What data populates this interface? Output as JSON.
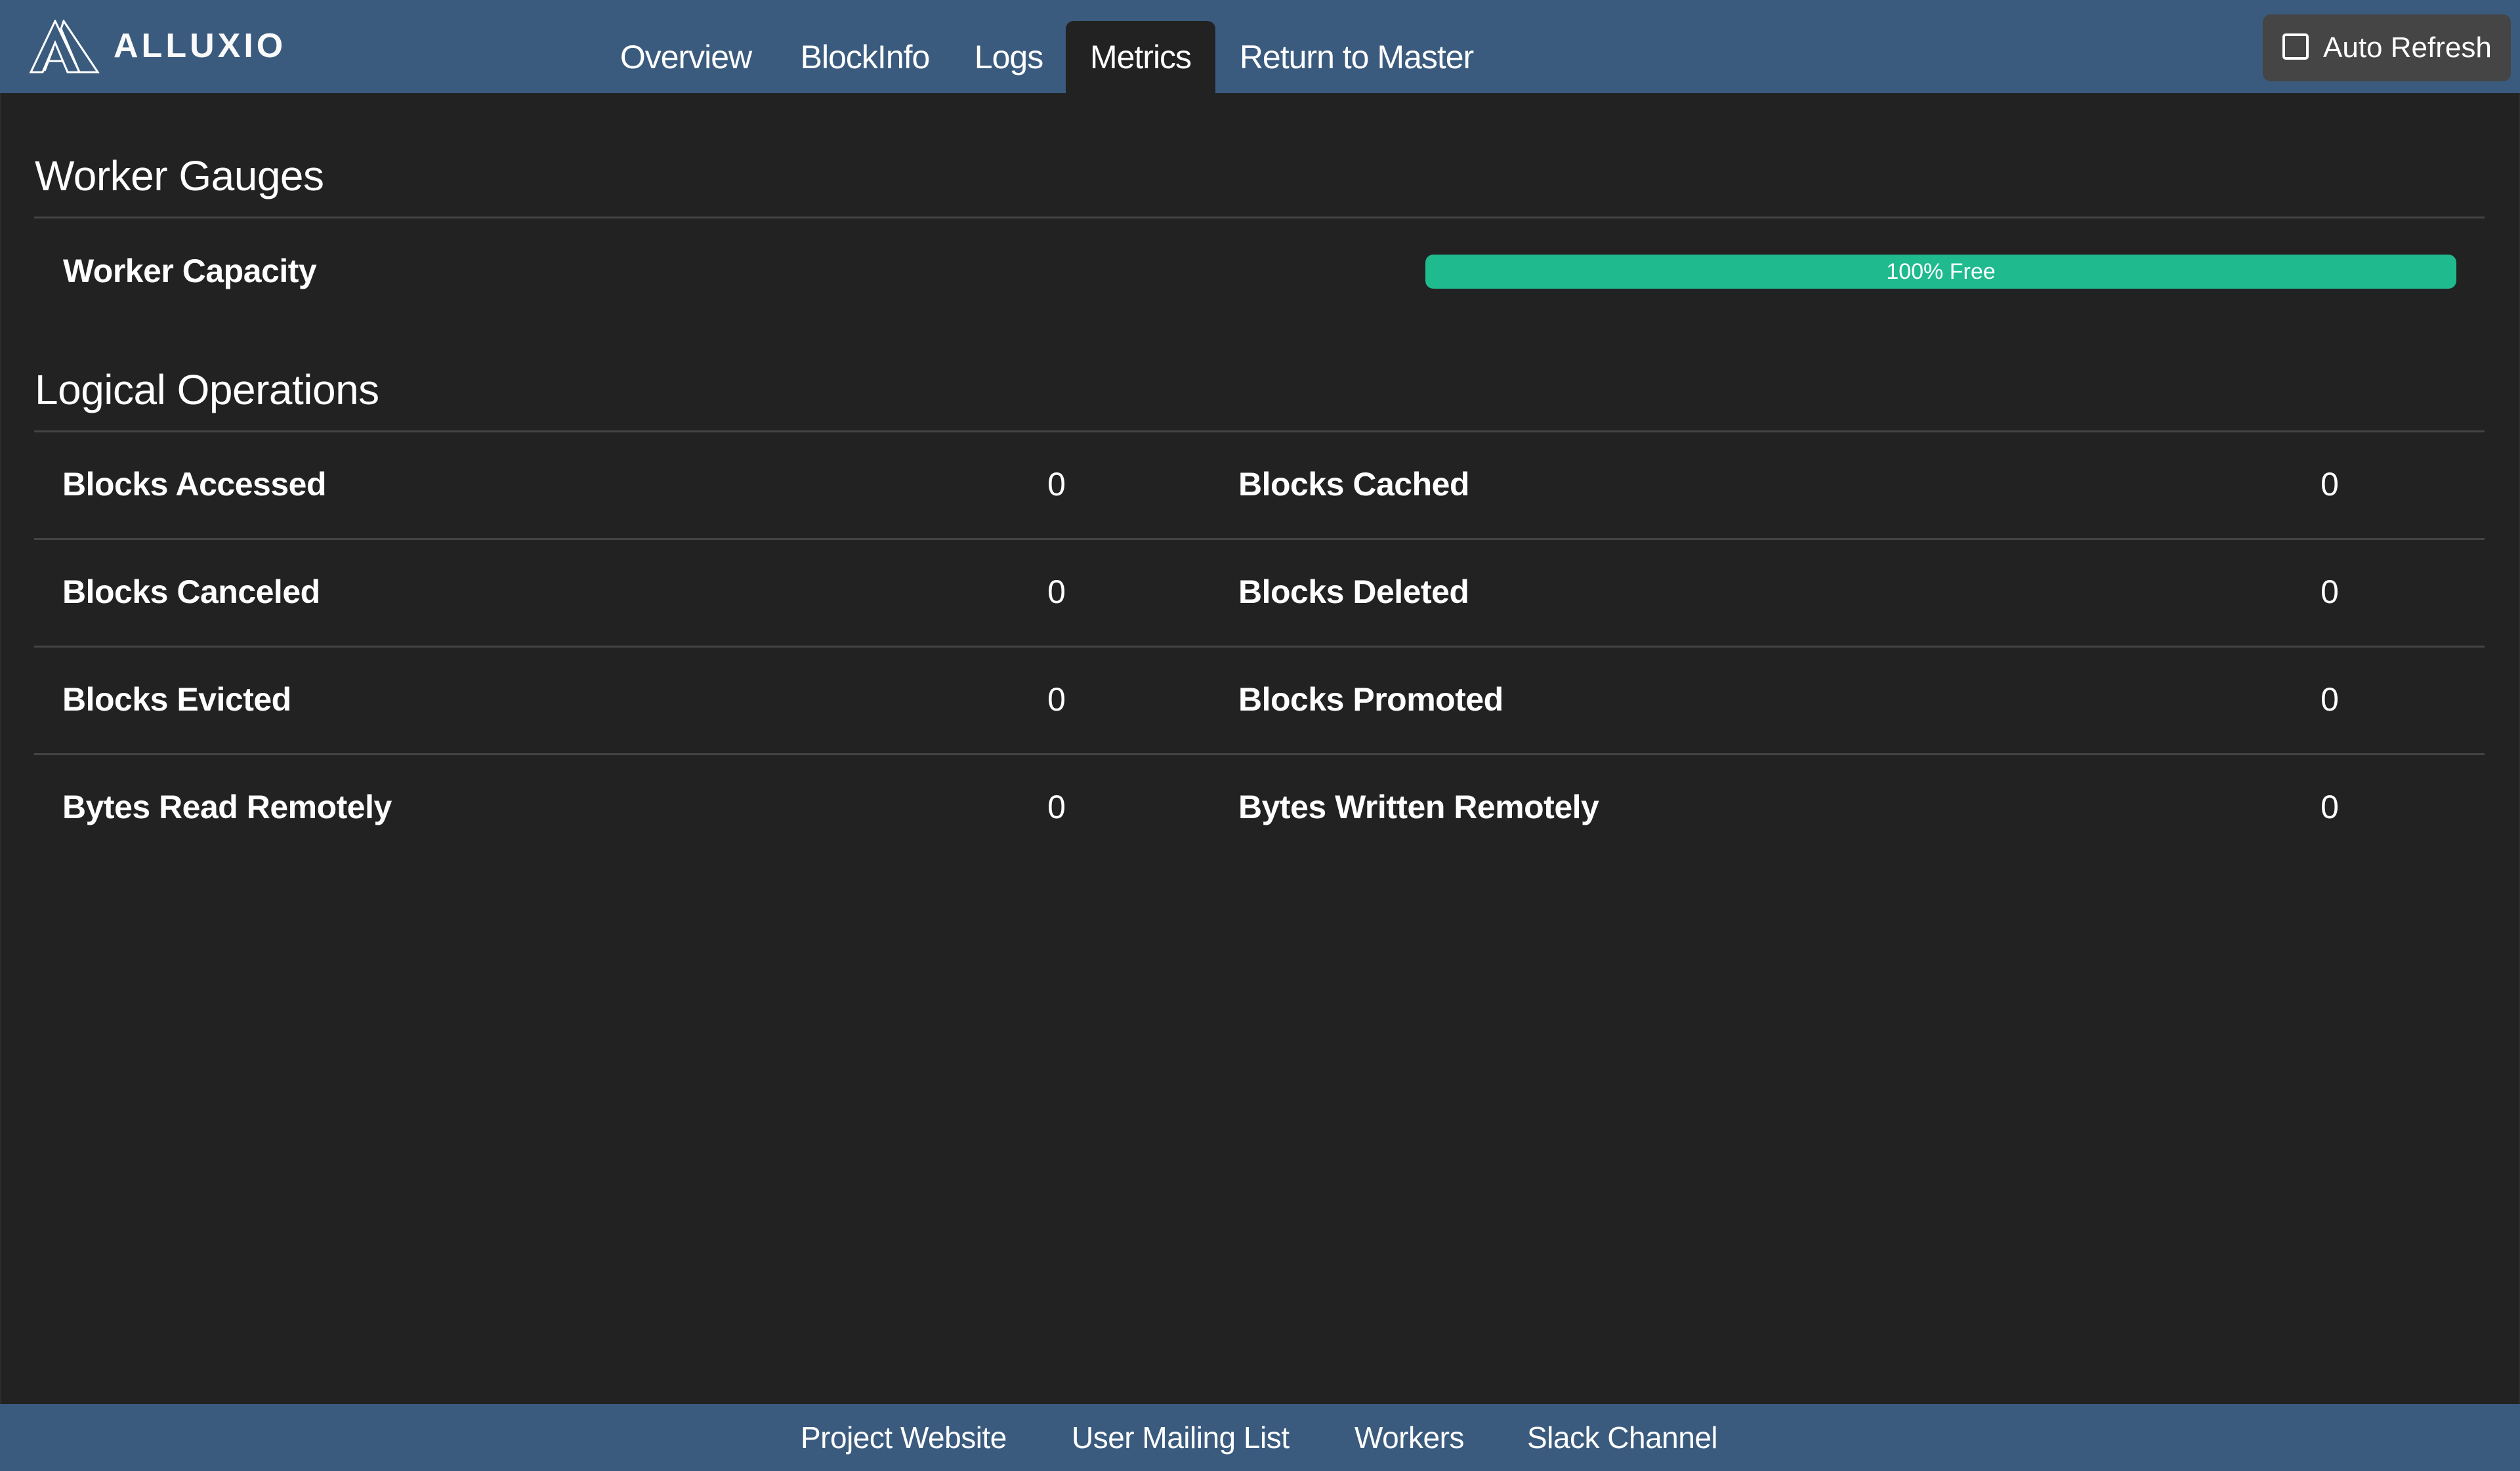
{
  "header": {
    "brand": "ALLUXIO",
    "logo_icon": "alluxio-logo-icon",
    "tabs": [
      {
        "label": "Overview",
        "active": false
      },
      {
        "label": "BlockInfo",
        "active": false
      },
      {
        "label": "Logs",
        "active": false
      },
      {
        "label": "Metrics",
        "active": true
      },
      {
        "label": "Return to Master",
        "active": false
      }
    ],
    "auto_refresh": {
      "label": "Auto Refresh",
      "checked": false,
      "icon": "checkbox-icon"
    }
  },
  "worker_gauges": {
    "title": "Worker Gauges",
    "capacity": {
      "label": "Worker Capacity",
      "free_percent": 100,
      "text": "100% Free",
      "color": "#1fbb8f"
    }
  },
  "logical_operations": {
    "title": "Logical Operations",
    "rows": [
      {
        "left": {
          "label": "Blocks Accessed",
          "value": "0"
        },
        "right": {
          "label": "Blocks Cached",
          "value": "0"
        }
      },
      {
        "left": {
          "label": "Blocks Canceled",
          "value": "0"
        },
        "right": {
          "label": "Blocks Deleted",
          "value": "0"
        }
      },
      {
        "left": {
          "label": "Blocks Evicted",
          "value": "0"
        },
        "right": {
          "label": "Blocks Promoted",
          "value": "0"
        }
      },
      {
        "left": {
          "label": "Bytes Read Remotely",
          "value": "0"
        },
        "right": {
          "label": "Bytes Written Remotely",
          "value": "0"
        }
      }
    ]
  },
  "footer": {
    "links": [
      "Project Website",
      "User Mailing List",
      "Workers",
      "Slack Channel"
    ]
  },
  "colors": {
    "header_bg": "#3a5b7e",
    "body_bg": "#222222",
    "progress": "#1fbb8f"
  }
}
